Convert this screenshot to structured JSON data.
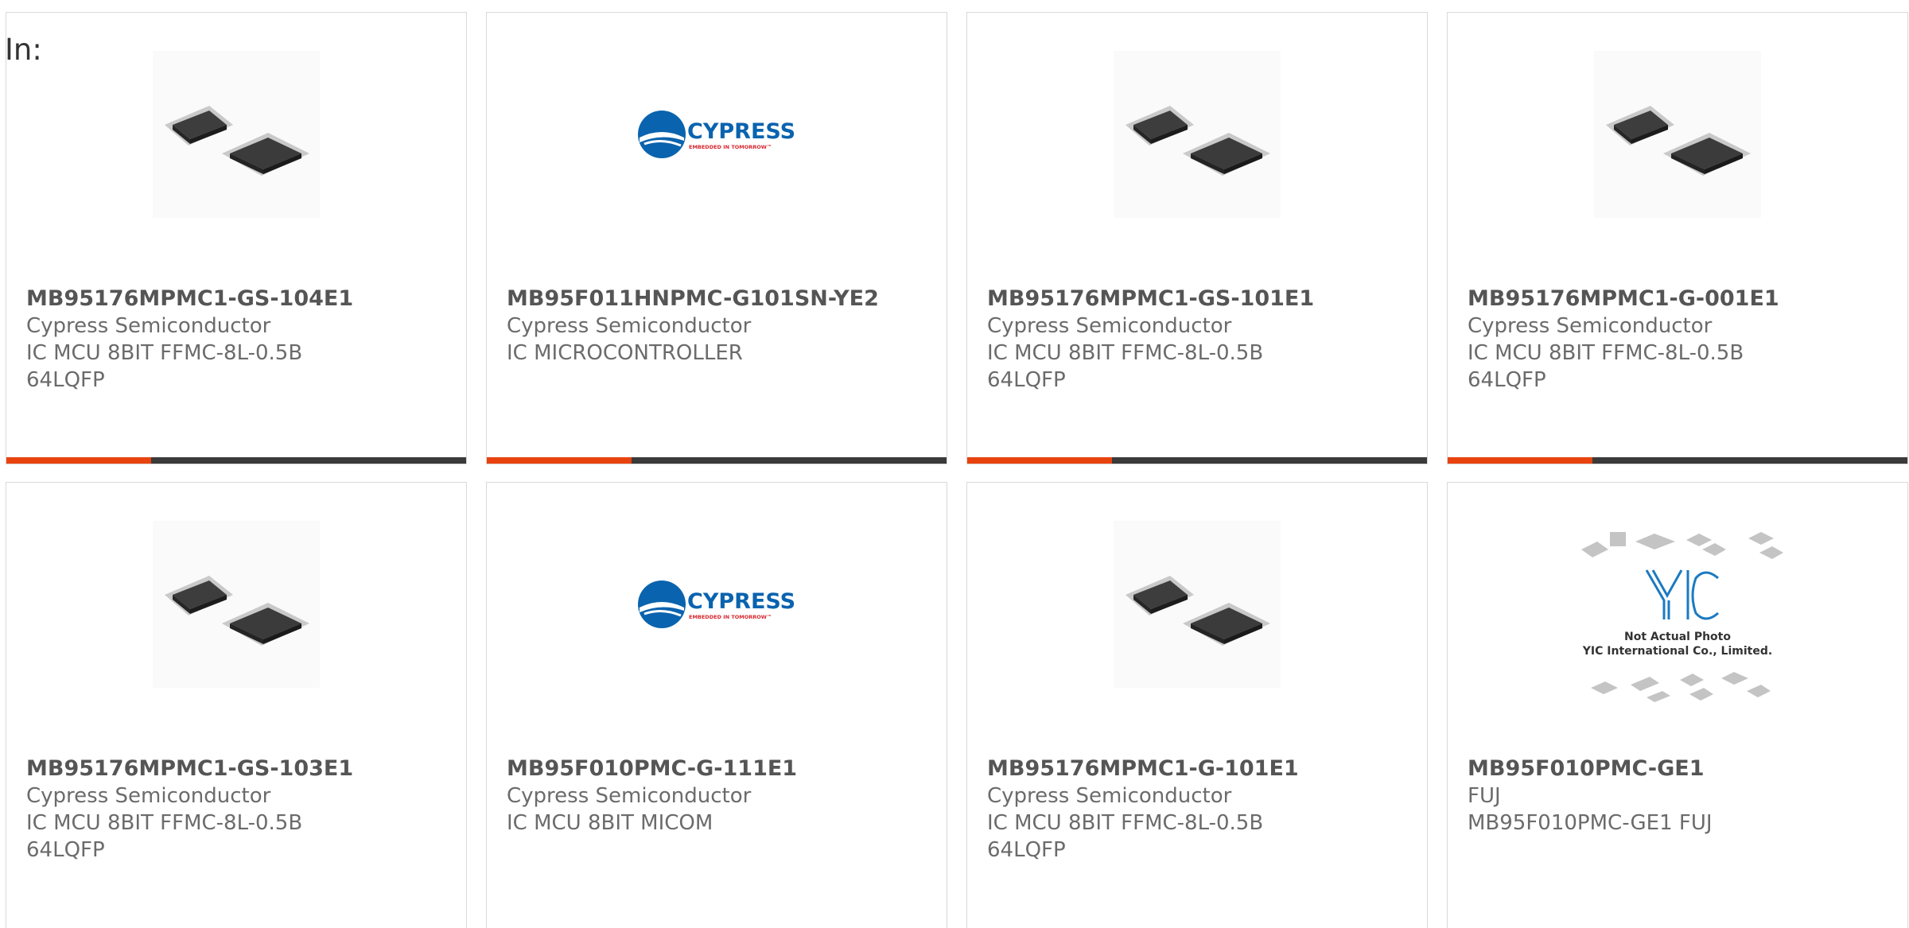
{
  "filter_label": "In:",
  "colors": {
    "accent": "#e8430f",
    "bar": "#3a3a3a",
    "border": "#d9d9d9"
  },
  "products": [
    {
      "part": "MB95176MPMC1-GS-104E1",
      "manufacturer": "Cypress Semiconductor",
      "description": "IC MCU 8BIT FFMC-8L-0.5B 64LQFP",
      "image": "chip-icon"
    },
    {
      "part": "MB95F011HNPMC-G101SN-YE2",
      "manufacturer": "Cypress Semiconductor",
      "description": "IC MICROCONTROLLER",
      "image": "cypress-logo",
      "logo_name": "CYPRESS",
      "logo_tagline": "EMBEDDED IN TOMORROW™"
    },
    {
      "part": "MB95176MPMC1-GS-101E1",
      "manufacturer": "Cypress Semiconductor",
      "description": "IC MCU 8BIT FFMC-8L-0.5B 64LQFP",
      "image": "chip-icon"
    },
    {
      "part": "MB95176MPMC1-G-001E1",
      "manufacturer": "Cypress Semiconductor",
      "description": "IC MCU 8BIT FFMC-8L-0.5B 64LQFP",
      "image": "chip-icon"
    },
    {
      "part": "MB95176MPMC1-GS-103E1",
      "manufacturer": "Cypress Semiconductor",
      "description": "IC MCU 8BIT FFMC-8L-0.5B 64LQFP",
      "image": "chip-icon"
    },
    {
      "part": "MB95F010PMC-G-111E1",
      "manufacturer": "Cypress Semiconductor",
      "description": "IC MCU 8BIT MICOM",
      "image": "cypress-logo",
      "logo_name": "CYPRESS",
      "logo_tagline": "EMBEDDED IN TOMORROW™"
    },
    {
      "part": "MB95176MPMC1-G-101E1",
      "manufacturer": "Cypress Semiconductor",
      "description": "IC MCU 8BIT FFMC-8L-0.5B 64LQFP",
      "image": "chip-icon"
    },
    {
      "part": "MB95F010PMC-GE1",
      "manufacturer": "FUJ",
      "description": "MB95F010PMC-GE1 FUJ",
      "image": "placeholder-photo",
      "logo_name": "YIC",
      "placeholder_line1": "Not Actual Photo",
      "placeholder_line2": "YIC International Co., Limited."
    }
  ]
}
